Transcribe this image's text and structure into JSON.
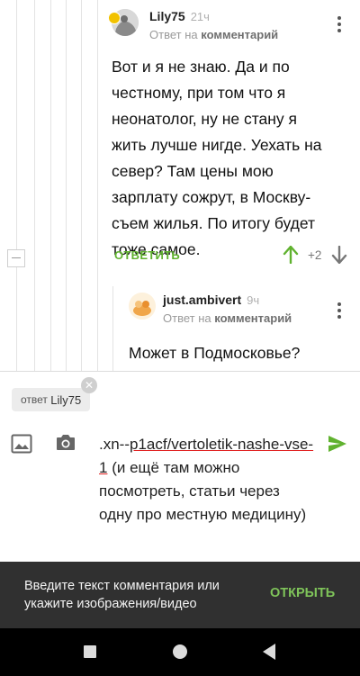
{
  "comment1": {
    "author": "Lily75",
    "time": "21ч",
    "reply_prefix": "Ответ на",
    "reply_target": "комментарий",
    "text": "Вот и я не знаю. Да и по честному, при том что я неонатолог, ну не стану я жить лучше нигде. Уехать на север? Там цены мою зарплату сожрут, в Москву- съем жилья. По итогу будет тоже самое.",
    "reply_label": "ОТВЕТИТЬ",
    "rating": "+2"
  },
  "comment2": {
    "author": "just.ambivert",
    "time": "9ч",
    "reply_prefix": "Ответ на",
    "reply_target": "комментарий",
    "text": "Может в Подмосковье?"
  },
  "composer": {
    "reply_chip_prefix": "ответ",
    "reply_chip_user": "Lily75",
    "text_line0": ".xn--",
    "link_text": "p1acf/vertoletik-nashe-vse-1",
    "text_rest": " (и ещё там можно посмотреть, статьи через одну про местную медицину)"
  },
  "snackbar": {
    "message": "Введите текст комментария или укажите изображения/видео",
    "action": "ОТКРЫТЬ"
  },
  "colors": {
    "accent_green": "#60b22f",
    "snackbar_bg": "#303030",
    "snackbar_action": "#7fc45a"
  }
}
